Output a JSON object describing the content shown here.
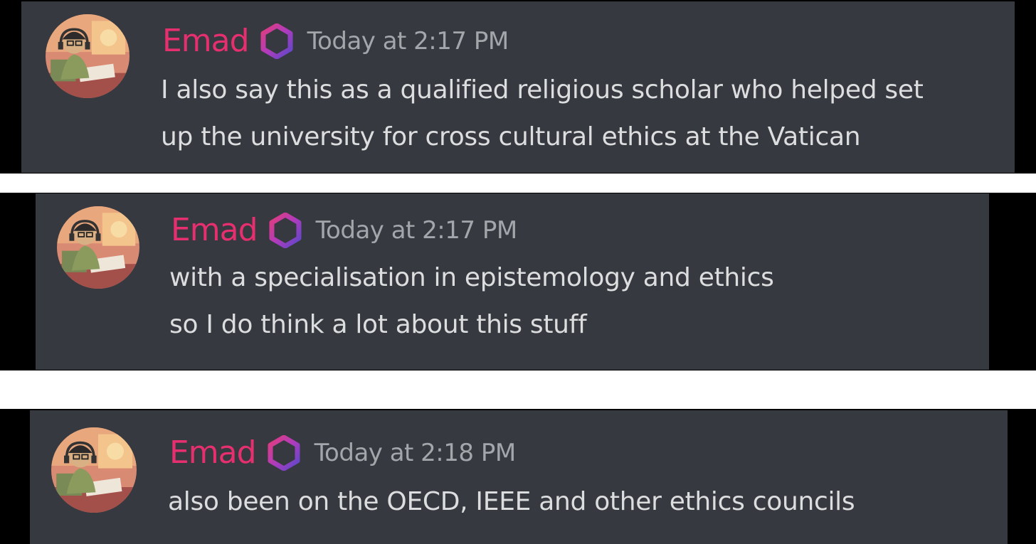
{
  "messages": [
    {
      "username": "Emad",
      "timestamp": "Today at 2:17 PM",
      "lines": [
        "I also say this as a qualified religious scholar who helped set",
        "up the university for cross cultural ethics at the Vatican"
      ]
    },
    {
      "username": "Emad",
      "timestamp": "Today at 2:17 PM",
      "lines": [
        "with a specialisation in epistemology and ethics",
        "so I do think a lot about this stuff"
      ]
    },
    {
      "username": "Emad",
      "timestamp": "Today at 2:18 PM",
      "lines": [
        "also been on the OECD, IEEE and other ethics councils"
      ]
    }
  ],
  "colors": {
    "username": "#e62f6e",
    "timestamp": "#a3a6aa",
    "message_text": "#dcddde",
    "panel_background": "#36393f",
    "frame_background": "#000000"
  },
  "icons": {
    "avatar": "cartoon-person-with-headphones-avatar",
    "badge": "hexagon-ring-badge-icon"
  }
}
